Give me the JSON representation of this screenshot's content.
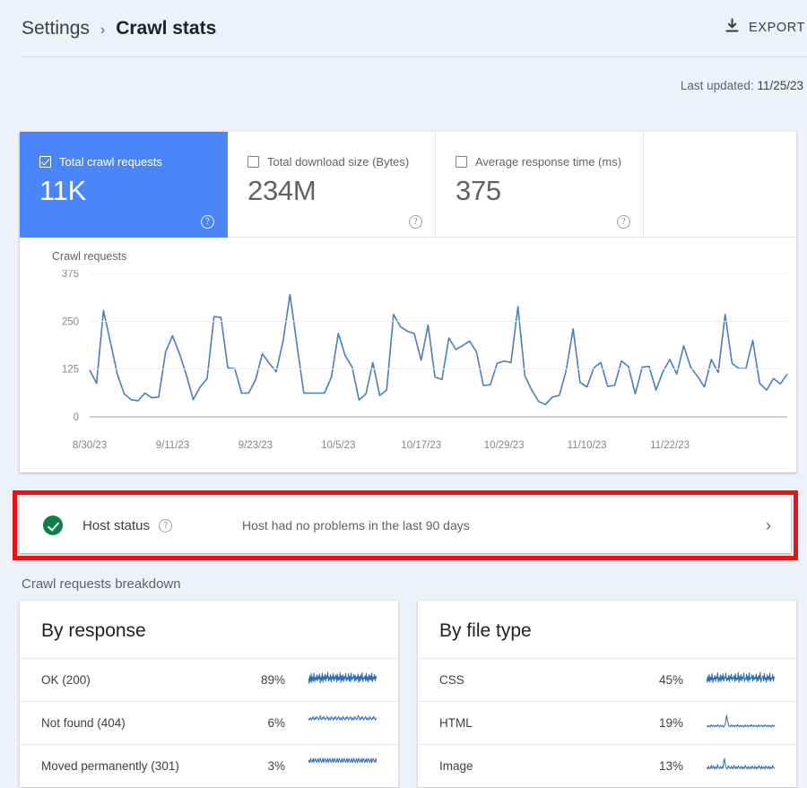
{
  "header": {
    "breadcrumb_parent": "Settings",
    "breadcrumb_sep": "›",
    "breadcrumb_current": "Crawl stats",
    "export_label": "EXPORT",
    "export_icon": "download-icon"
  },
  "last_updated": {
    "label": "Last updated:",
    "value": "11/25/23"
  },
  "metrics": [
    {
      "label": "Total crawl requests",
      "value": "11K",
      "checked": true,
      "help_icon": "help-icon"
    },
    {
      "label": "Total download size (Bytes)",
      "value": "234M",
      "checked": false,
      "help_icon": "help-icon"
    },
    {
      "label": "Average response time (ms)",
      "value": "375",
      "checked": false,
      "help_icon": "help-icon"
    }
  ],
  "host_status": {
    "status_icon": "check-circle-icon",
    "title": "Host status",
    "help_icon": "help-icon",
    "message": "Host had no problems in the last 90 days",
    "chevron_icon": "chevron-right-icon",
    "highlight_color": "#e61414"
  },
  "breakdown": {
    "title": "Crawl requests breakdown",
    "cards": [
      {
        "title": "By response",
        "rows": [
          {
            "name": "OK (200)",
            "percent": "89%",
            "sparkline": [
              62,
              30,
              75,
              40,
              88,
              35,
              70,
              45,
              92,
              38,
              66,
              50,
              80,
              42,
              74,
              55,
              86,
              33,
              69,
              47,
              90,
              36,
              72,
              52,
              84,
              41,
              77,
              58,
              95,
              44,
              68,
              49,
              82,
              37,
              73,
              54,
              88,
              43,
              71,
              56,
              79,
              39,
              85,
              46,
              67,
              51,
              93,
              35,
              76,
              48,
              81,
              40,
              70,
              57,
              89,
              42,
              64,
              53,
              87,
              45,
              74,
              38,
              91,
              50,
              66,
              59,
              83,
              41,
              78,
              47,
              69,
              55,
              86,
              36,
              72,
              44,
              80,
              52,
              94,
              39,
              65,
              56,
              75,
              43,
              88,
              48,
              70,
              37,
              82,
              51,
              77,
              46,
              90,
              40,
              68,
              54,
              84,
              42,
              73,
              58
            ]
          },
          {
            "name": "Not found (404)",
            "percent": "6%",
            "sparkline": [
              10,
              11,
              10,
              12,
              11,
              10,
              12,
              13,
              11,
              10,
              12,
              11,
              13,
              12,
              11,
              10,
              12,
              14,
              11,
              10,
              12,
              11,
              13,
              12,
              10,
              11,
              12,
              13,
              11,
              10,
              12,
              11,
              10,
              13,
              12,
              11,
              10,
              12,
              11,
              13,
              12,
              10,
              11,
              12,
              13,
              11,
              10,
              12,
              11,
              10,
              13,
              12,
              11,
              10,
              12,
              11,
              13,
              12,
              10,
              11,
              12,
              13,
              11,
              10,
              12,
              11,
              10,
              13,
              12,
              11,
              10,
              12,
              14,
              13,
              11,
              10,
              12,
              11,
              13,
              12,
              10,
              11,
              12,
              13,
              11,
              10,
              12,
              11,
              10,
              13,
              12,
              11,
              10,
              12,
              11,
              13,
              12,
              10,
              11,
              12
            ]
          },
          {
            "name": "Moved permanently (301)",
            "percent": "3%",
            "sparkline": [
              6,
              7,
              6,
              8,
              7,
              6,
              7,
              8,
              6,
              7,
              8,
              7,
              6,
              7,
              8,
              6,
              7,
              8,
              7,
              6,
              7,
              8,
              6,
              7,
              8,
              7,
              6,
              7,
              8,
              6,
              7,
              8,
              7,
              6,
              7,
              8,
              6,
              7,
              8,
              7,
              6,
              7,
              8,
              6,
              7,
              8,
              7,
              6,
              7,
              8,
              6,
              7,
              8,
              7,
              6,
              7,
              8,
              6,
              7,
              8,
              7,
              6,
              7,
              8,
              6,
              7,
              8,
              7,
              6,
              7,
              8,
              6,
              7,
              8,
              7,
              6,
              7,
              8,
              6,
              7,
              8,
              7,
              6,
              7,
              8,
              6,
              7,
              8,
              7,
              6,
              7,
              8,
              6,
              7,
              8,
              7,
              6,
              7,
              8,
              6
            ]
          }
        ]
      },
      {
        "title": "By file type",
        "rows": [
          {
            "name": "CSS",
            "percent": "45%",
            "sparkline": [
              58,
              34,
              70,
              42,
              80,
              36,
              64,
              48,
              86,
              33,
              60,
              52,
              74,
              40,
              68,
              55,
              90,
              35,
              62,
              46,
              78,
              38,
              72,
              50,
              84,
              41,
              66,
              57,
              88,
              43,
              59,
              49,
              76,
              37,
              70,
              54,
              82,
              44,
              63,
              56,
              73,
              39,
              85,
              45,
              61,
              51,
              91,
              34,
              69,
              47,
              79,
              42,
              65,
              58,
              87,
              40,
              57,
              53,
              81,
              46,
              71,
              36,
              89,
              50,
              60,
              59,
              77,
              41,
              75,
              48,
              64,
              55,
              83,
              38,
              67,
              44,
              74,
              52,
              92,
              37,
              56,
              57,
              72,
              43,
              86,
              49,
              62,
              35,
              78,
              51,
              70,
              46,
              88,
              40,
              61,
              54,
              80,
              42,
              66,
              58
            ]
          },
          {
            "name": "HTML",
            "percent": "19%",
            "sparkline": [
              18,
              20,
              17,
              22,
              19,
              16,
              21,
              24,
              18,
              20,
              23,
              19,
              17,
              22,
              20,
              18,
              25,
              21,
              19,
              17,
              23,
              20,
              18,
              22,
              19,
              16,
              21,
              24,
              40,
              58,
              46,
              35,
              22,
              19,
              17,
              21,
              24,
              18,
              20,
              23,
              19,
              17,
              22,
              20,
              18,
              25,
              21,
              19,
              17,
              23,
              20,
              18,
              22,
              19,
              16,
              21,
              24,
              18,
              20,
              23,
              19,
              17,
              22,
              20,
              18,
              25,
              21,
              19,
              17,
              23,
              20,
              18,
              22,
              19,
              16,
              21,
              24,
              18,
              20,
              23,
              19,
              17,
              22,
              20,
              18,
              25,
              21,
              19,
              17,
              23,
              20,
              18,
              22,
              19,
              16,
              21,
              24,
              18,
              20,
              23
            ]
          },
          {
            "name": "Image",
            "percent": "13%",
            "sparkline": [
              12,
              15,
              13,
              18,
              14,
              12,
              16,
              20,
              13,
              15,
              19,
              14,
              12,
              17,
              15,
              13,
              22,
              16,
              14,
              12,
              18,
              15,
              13,
              17,
              14,
              28,
              35,
              24,
              16,
              13,
              12,
              17,
              19,
              14,
              15,
              13,
              18,
              16,
              12,
              15,
              20,
              14,
              13,
              17,
              15,
              12,
              19,
              16,
              14,
              13,
              18,
              15,
              12,
              17,
              14,
              13,
              20,
              16,
              15,
              12,
              18,
              14,
              13,
              17,
              15,
              12,
              19,
              16,
              14,
              13,
              18,
              15,
              12,
              17,
              14,
              13,
              20,
              16,
              15,
              12,
              18,
              14,
              13,
              17,
              15,
              12,
              19,
              16,
              14,
              13,
              18,
              15,
              12,
              17,
              14,
              13,
              20,
              16,
              15,
              12
            ]
          }
        ]
      }
    ]
  },
  "chart_data": {
    "type": "line",
    "title": "Crawl requests",
    "xlabel": "",
    "ylabel": "Crawl requests",
    "ylim": [
      0,
      375
    ],
    "yticks": [
      0,
      125,
      250,
      375
    ],
    "grid": true,
    "legend": null,
    "line_color": "#4a7ebb",
    "xticks": [
      "8/30/23",
      "9/11/23",
      "9/23/23",
      "10/5/23",
      "10/17/23",
      "10/29/23",
      "11/10/23",
      "11/22/23"
    ],
    "x_start": "8/30/23",
    "x_end": "11/25/23",
    "values": [
      122,
      88,
      278,
      196,
      112,
      60,
      45,
      42,
      62,
      50,
      52,
      170,
      212,
      166,
      110,
      45,
      78,
      100,
      262,
      260,
      128,
      126,
      62,
      62,
      96,
      165,
      140,
      118,
      198,
      320,
      190,
      62,
      62,
      62,
      62,
      104,
      218,
      160,
      130,
      44,
      60,
      142,
      56,
      70,
      268,
      236,
      224,
      218,
      148,
      240,
      104,
      98,
      206,
      176,
      186,
      198,
      170,
      82,
      84,
      140,
      146,
      142,
      288,
      108,
      70,
      40,
      32,
      52,
      56,
      122,
      230,
      90,
      78,
      128,
      142,
      80,
      82,
      146,
      132,
      60,
      130,
      132,
      70,
      118,
      150,
      112,
      186,
      130,
      106,
      78,
      150,
      116,
      268,
      140,
      126,
      126,
      200,
      88,
      70,
      100,
      86,
      112
    ]
  }
}
